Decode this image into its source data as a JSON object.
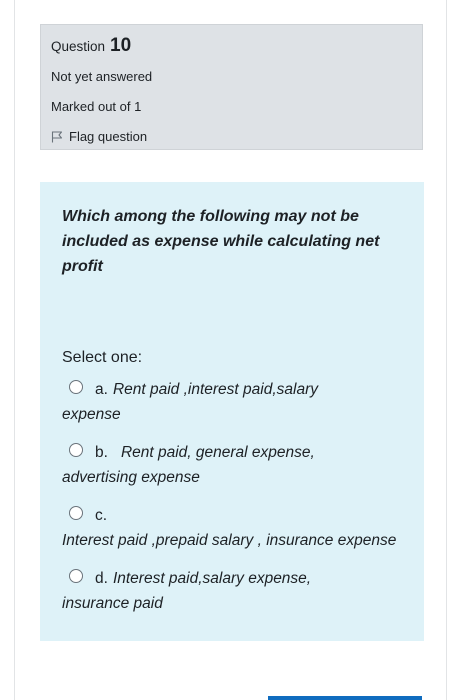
{
  "question_info": {
    "label": "Question",
    "number": "10",
    "state": "Not yet answered",
    "grade": "Marked out of 1",
    "flag_label": "Flag question"
  },
  "question": {
    "text": "Which among the following may not be included as expense while calculating net profit",
    "select_label": "Select one:",
    "options": [
      {
        "letter": "a.",
        "line1": "Rent paid ,interest paid,salary",
        "line2": "expense"
      },
      {
        "letter": "b.",
        "line1": "Rent paid, general expense,",
        "line2": "advertising expense"
      },
      {
        "letter": "c.",
        "line1": "",
        "line2": "Interest paid ,prepaid salary , insurance expense"
      },
      {
        "letter": "d.",
        "line1": "Interest paid,salary expense,",
        "line2": "insurance paid"
      }
    ]
  },
  "colors": {
    "info_bg": "#dee2e6",
    "formulation_bg": "#def2f8",
    "accent": "#0f6cbf"
  }
}
